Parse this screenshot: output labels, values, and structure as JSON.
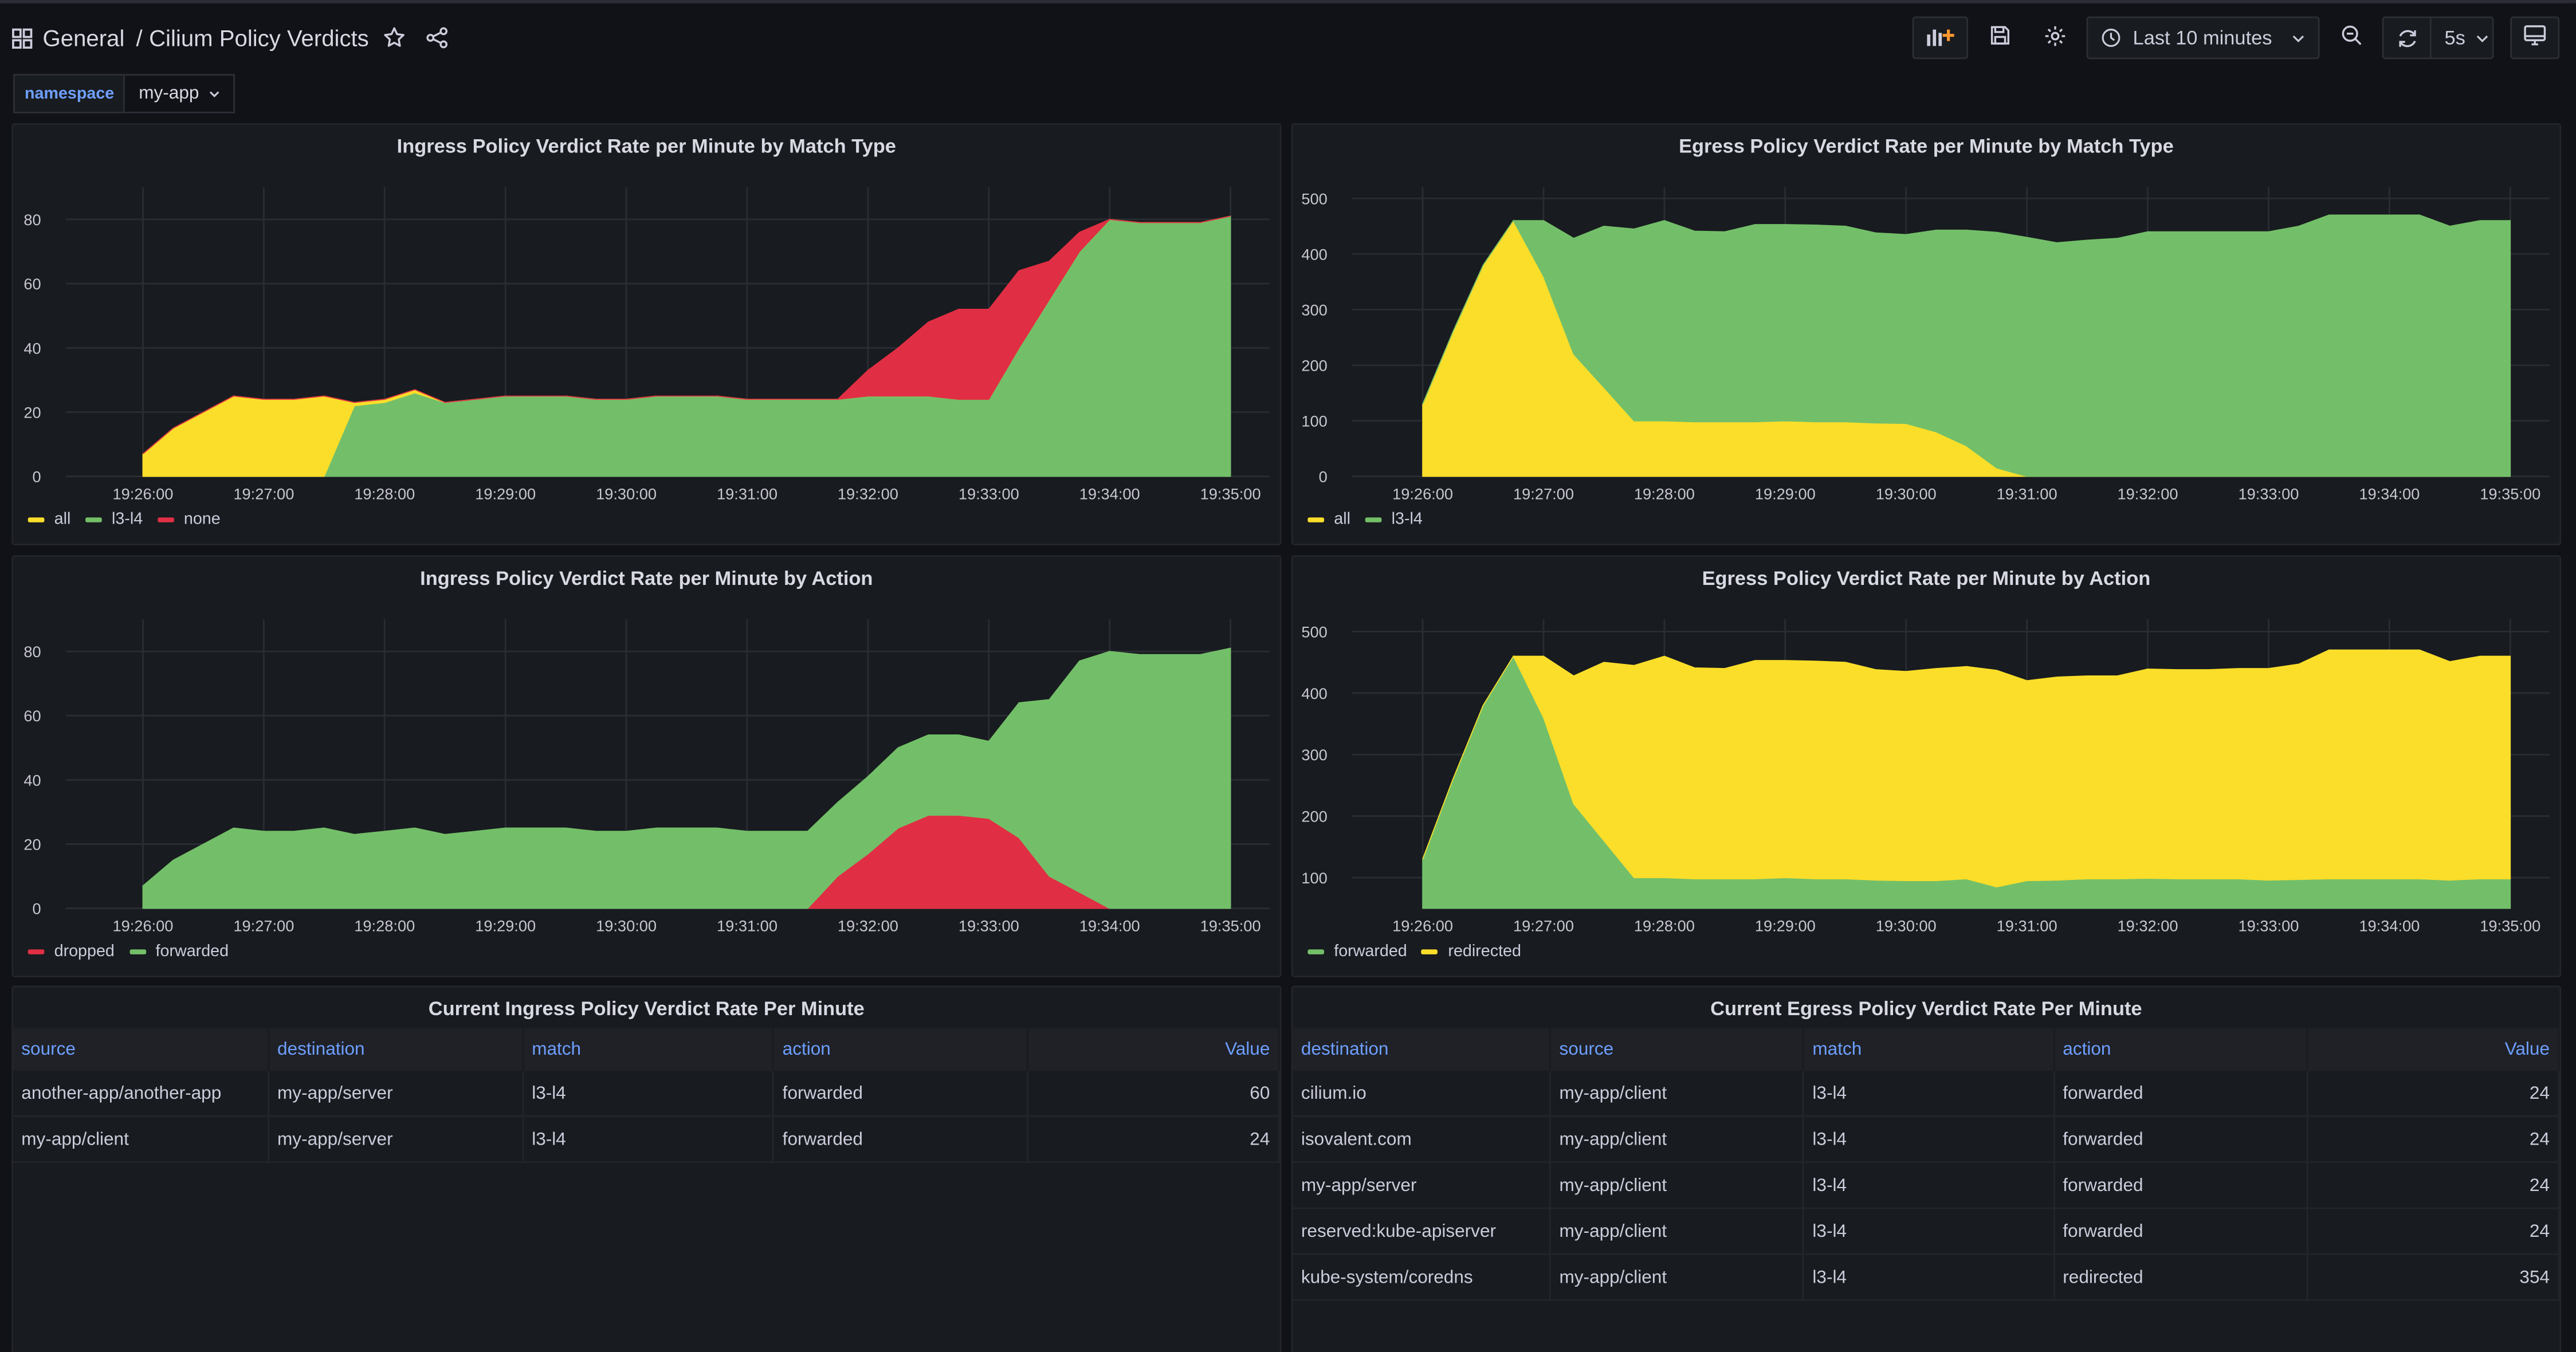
{
  "nav": {
    "folder": "General",
    "separator": "/",
    "title": "Cilium Policy Verdicts",
    "time_range": "Last 10 minutes",
    "refresh": "5s"
  },
  "variables": {
    "namespace_label": "namespace",
    "namespace_value": "my-app"
  },
  "colors": {
    "green": "#73bf69",
    "yellow": "#fade2a",
    "red": "#e02f44",
    "grid": "#2a2c33",
    "axis": "#c7c7d1"
  },
  "time_ticks": [
    "19:26:00",
    "19:27:00",
    "19:28:00",
    "19:29:00",
    "19:30:00",
    "19:31:00",
    "19:32:00",
    "19:33:00",
    "19:34:00",
    "19:35:00"
  ],
  "panels": {
    "ingress_match": {
      "title": "Ingress Policy Verdict Rate per Minute by Match Type",
      "legend": [
        {
          "name": "all",
          "color": "#fade2a"
        },
        {
          "name": "l3-l4",
          "color": "#73bf69"
        },
        {
          "name": "none",
          "color": "#e02f44"
        }
      ]
    },
    "egress_match": {
      "title": "Egress Policy Verdict Rate per Minute by Match Type",
      "legend": [
        {
          "name": "all",
          "color": "#fade2a"
        },
        {
          "name": "l3-l4",
          "color": "#73bf69"
        }
      ]
    },
    "ingress_action": {
      "title": "Ingress Policy Verdict Rate per Minute by Action",
      "legend": [
        {
          "name": "dropped",
          "color": "#e02f44"
        },
        {
          "name": "forwarded",
          "color": "#73bf69"
        }
      ]
    },
    "egress_action": {
      "title": "Egress Policy Verdict Rate per Minute by Action",
      "legend": [
        {
          "name": "forwarded",
          "color": "#73bf69"
        },
        {
          "name": "redirected",
          "color": "#fade2a"
        }
      ]
    },
    "ingress_table": {
      "title": "Current Ingress Policy Verdict Rate Per Minute",
      "columns": [
        "source",
        "destination",
        "match",
        "action",
        "Value"
      ],
      "rows": [
        [
          "another-app/another-app",
          "my-app/server",
          "l3-l4",
          "forwarded",
          "60"
        ],
        [
          "my-app/client",
          "my-app/server",
          "l3-l4",
          "forwarded",
          "24"
        ]
      ]
    },
    "egress_table": {
      "title": "Current Egress Policy Verdict Rate Per Minute",
      "columns": [
        "destination",
        "source",
        "match",
        "action",
        "Value"
      ],
      "rows": [
        [
          "cilium.io",
          "my-app/client",
          "l3-l4",
          "forwarded",
          "24"
        ],
        [
          "isovalent.com",
          "my-app/client",
          "l3-l4",
          "forwarded",
          "24"
        ],
        [
          "my-app/server",
          "my-app/client",
          "l3-l4",
          "forwarded",
          "24"
        ],
        [
          "reserved:kube-apiserver",
          "my-app/client",
          "l3-l4",
          "forwarded",
          "24"
        ],
        [
          "kube-system/coredns",
          "my-app/client",
          "l3-l4",
          "redirected",
          "354"
        ]
      ]
    }
  },
  "chart_data": [
    {
      "type": "area",
      "title": "Ingress Policy Verdict Rate per Minute by Match Type",
      "x": [
        "19:26:00",
        "19:26:15",
        "19:26:30",
        "19:26:45",
        "19:27:00",
        "19:27:15",
        "19:27:30",
        "19:27:45",
        "19:28:00",
        "19:28:15",
        "19:28:30",
        "19:28:45",
        "19:29:00",
        "19:29:15",
        "19:29:30",
        "19:29:45",
        "19:30:00",
        "19:30:15",
        "19:30:30",
        "19:30:45",
        "19:31:00",
        "19:31:15",
        "19:31:30",
        "19:31:45",
        "19:32:00",
        "19:32:15",
        "19:32:30",
        "19:32:45",
        "19:33:00",
        "19:33:15",
        "19:33:30",
        "19:33:45",
        "19:34:00",
        "19:34:15",
        "19:34:30",
        "19:34:45",
        "19:35:00"
      ],
      "ylim": [
        0,
        90
      ],
      "yticks": [
        0,
        20,
        40,
        60,
        80
      ],
      "series": [
        {
          "name": "l3-l4",
          "color": "#73bf69",
          "values": [
            0,
            0,
            0,
            0,
            0,
            0,
            0,
            22,
            23,
            26,
            23,
            24,
            25,
            25,
            25,
            24,
            24,
            25,
            25,
            25,
            24,
            24,
            24,
            24,
            25,
            25,
            25,
            24,
            24,
            40,
            55,
            70,
            80,
            79,
            79,
            79,
            81
          ]
        },
        {
          "name": "all",
          "color": "#fade2a",
          "values": [
            7,
            15,
            20,
            25,
            24,
            24,
            25,
            1,
            1,
            1,
            0,
            0,
            0,
            0,
            0,
            0,
            0,
            0,
            0,
            0,
            0,
            0,
            0,
            0,
            0,
            0,
            0,
            0,
            0,
            0,
            0,
            0,
            0,
            0,
            0,
            0,
            0
          ]
        },
        {
          "name": "none",
          "color": "#e02f44",
          "values": [
            0,
            0,
            0,
            0,
            0,
            0,
            0,
            0,
            0,
            0,
            0,
            0,
            0,
            0,
            0,
            0,
            0,
            0,
            0,
            0,
            0,
            0,
            0,
            0,
            8,
            15,
            23,
            28,
            28,
            24,
            12,
            6,
            0,
            0,
            0,
            0,
            0
          ]
        }
      ]
    },
    {
      "type": "area",
      "title": "Egress Policy Verdict Rate per Minute by Match Type",
      "x": [
        "19:26:00",
        "19:26:15",
        "19:26:30",
        "19:26:45",
        "19:27:00",
        "19:27:15",
        "19:27:30",
        "19:27:45",
        "19:28:00",
        "19:28:15",
        "19:28:30",
        "19:28:45",
        "19:29:00",
        "19:29:15",
        "19:29:30",
        "19:29:45",
        "19:30:00",
        "19:30:15",
        "19:30:30",
        "19:30:45",
        "19:31:00",
        "19:31:15",
        "19:31:30",
        "19:31:45",
        "19:32:00",
        "19:32:15",
        "19:32:30",
        "19:32:45",
        "19:33:00",
        "19:33:15",
        "19:33:30",
        "19:33:45",
        "19:34:00",
        "19:34:15",
        "19:34:30",
        "19:34:45",
        "19:35:00"
      ],
      "ylim": [
        0,
        520
      ],
      "yticks": [
        0,
        100,
        200,
        300,
        400,
        500
      ],
      "series": [
        {
          "name": "all",
          "color": "#fade2a",
          "values": [
            130,
            260,
            380,
            460,
            360,
            220,
            160,
            100,
            100,
            98,
            98,
            98,
            100,
            98,
            98,
            96,
            95,
            80,
            55,
            15,
            0,
            0,
            0,
            0,
            0,
            0,
            0,
            0,
            0,
            0,
            0,
            0,
            0,
            0,
            0,
            0,
            0
          ]
        },
        {
          "name": "l3-l4",
          "color": "#73bf69",
          "values": [
            0,
            0,
            0,
            0,
            100,
            208,
            290,
            345,
            360,
            343,
            342,
            355,
            353,
            354,
            352,
            342,
            340,
            363,
            388,
            424,
            430,
            420,
            425,
            428,
            440,
            440,
            440,
            440,
            440,
            450,
            470,
            470,
            470,
            470,
            450,
            460,
            460
          ]
        }
      ]
    },
    {
      "type": "area",
      "title": "Ingress Policy Verdict Rate per Minute by Action",
      "x": [
        "19:26:00",
        "19:26:15",
        "19:26:30",
        "19:26:45",
        "19:27:00",
        "19:27:15",
        "19:27:30",
        "19:27:45",
        "19:28:00",
        "19:28:15",
        "19:28:30",
        "19:28:45",
        "19:29:00",
        "19:29:15",
        "19:29:30",
        "19:29:45",
        "19:30:00",
        "19:30:15",
        "19:30:30",
        "19:30:45",
        "19:31:00",
        "19:31:15",
        "19:31:30",
        "19:31:45",
        "19:32:00",
        "19:32:15",
        "19:32:30",
        "19:32:45",
        "19:33:00",
        "19:33:15",
        "19:33:30",
        "19:33:45",
        "19:34:00",
        "19:34:15",
        "19:34:30",
        "19:34:45",
        "19:35:00"
      ],
      "ylim": [
        0,
        90
      ],
      "yticks": [
        0,
        20,
        40,
        60,
        80
      ],
      "series": [
        {
          "name": "dropped",
          "color": "#e02f44",
          "values": [
            0,
            0,
            0,
            0,
            0,
            0,
            0,
            0,
            0,
            0,
            0,
            0,
            0,
            0,
            0,
            0,
            0,
            0,
            0,
            0,
            0,
            0,
            0,
            10,
            17,
            25,
            29,
            29,
            28,
            22,
            10,
            5,
            0,
            0,
            0,
            0,
            0
          ]
        },
        {
          "name": "forwarded",
          "color": "#73bf69",
          "values": [
            7,
            15,
            20,
            25,
            24,
            24,
            25,
            23,
            24,
            25,
            23,
            24,
            25,
            25,
            25,
            24,
            24,
            25,
            25,
            25,
            24,
            24,
            24,
            23,
            24,
            25,
            25,
            25,
            24,
            42,
            55,
            72,
            80,
            79,
            79,
            79,
            81
          ]
        }
      ]
    },
    {
      "type": "area",
      "title": "Egress Policy Verdict Rate per Minute by Action",
      "x": [
        "19:26:00",
        "19:26:15",
        "19:26:30",
        "19:26:45",
        "19:27:00",
        "19:27:15",
        "19:27:30",
        "19:27:45",
        "19:28:00",
        "19:28:15",
        "19:28:30",
        "19:28:45",
        "19:29:00",
        "19:29:15",
        "19:29:30",
        "19:29:45",
        "19:30:00",
        "19:30:15",
        "19:30:30",
        "19:30:45",
        "19:31:00",
        "19:31:15",
        "19:31:30",
        "19:31:45",
        "19:32:00",
        "19:32:15",
        "19:32:30",
        "19:32:45",
        "19:33:00",
        "19:33:15",
        "19:33:30",
        "19:33:45",
        "19:34:00",
        "19:34:15",
        "19:34:30",
        "19:34:45",
        "19:35:00"
      ],
      "ylim": [
        50,
        520
      ],
      "yticks": [
        100,
        200,
        300,
        400,
        500
      ],
      "series": [
        {
          "name": "forwarded",
          "color": "#73bf69",
          "values": [
            130,
            260,
            380,
            460,
            360,
            220,
            160,
            100,
            100,
            98,
            98,
            98,
            100,
            98,
            98,
            96,
            95,
            95,
            98,
            85,
            95,
            96,
            98,
            98,
            99,
            98,
            98,
            98,
            96,
            97,
            98,
            98,
            98,
            98,
            96,
            98,
            98
          ]
        },
        {
          "name": "redirected",
          "color": "#fade2a",
          "values": [
            0,
            0,
            0,
            0,
            100,
            208,
            290,
            345,
            360,
            343,
            342,
            355,
            353,
            354,
            352,
            342,
            340,
            345,
            345,
            352,
            325,
            330,
            330,
            330,
            340,
            340,
            340,
            342,
            344,
            350,
            372,
            372,
            372,
            372,
            355,
            362,
            362
          ]
        }
      ]
    }
  ]
}
